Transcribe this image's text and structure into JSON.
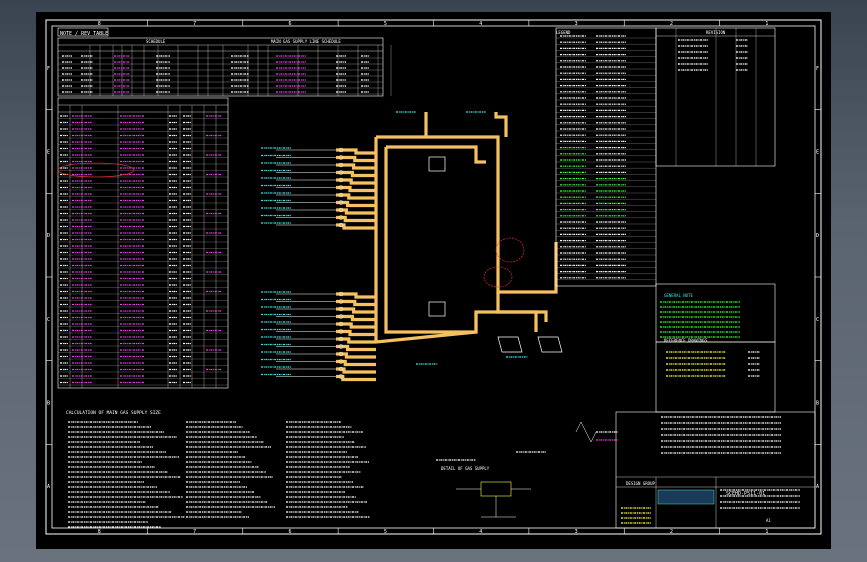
{
  "drawing": {
    "title_block_text": "DESIGN GROUP",
    "drawing_number": "SCEHD-P511-01",
    "scale_label": "AS SHOWN",
    "sheet_label": "A1",
    "top_left_tag": "NOTE / REV TABLE",
    "zone_columns": [
      "8",
      "7",
      "6",
      "5",
      "4",
      "3",
      "2",
      "1"
    ],
    "zone_rows": [
      "F",
      "E",
      "D",
      "C",
      "B",
      "A"
    ]
  },
  "tables": {
    "top_header": "SCHEDULE",
    "mid_header": "MAIN GAS SUPPLY LINE SCHEDULE",
    "right_legend_title": "LEGEND",
    "revision_title": "REVISION",
    "reference_title": "REFERENCE DRAWINGS",
    "notes_title": "GENERAL NOTE"
  },
  "annotations": {
    "calc_title": "CALCULATION OF MAIN GAS SUPPLY SIZE",
    "detail_title": "DETAIL OF GAS SUPPLY"
  },
  "colors": {
    "pipe": "#f5c060",
    "line": "#ffffff",
    "magenta": "#e040e0",
    "cyan": "#40e0e0",
    "green": "#40ff40",
    "yellow": "#ffff40",
    "red": "#ff3030"
  }
}
